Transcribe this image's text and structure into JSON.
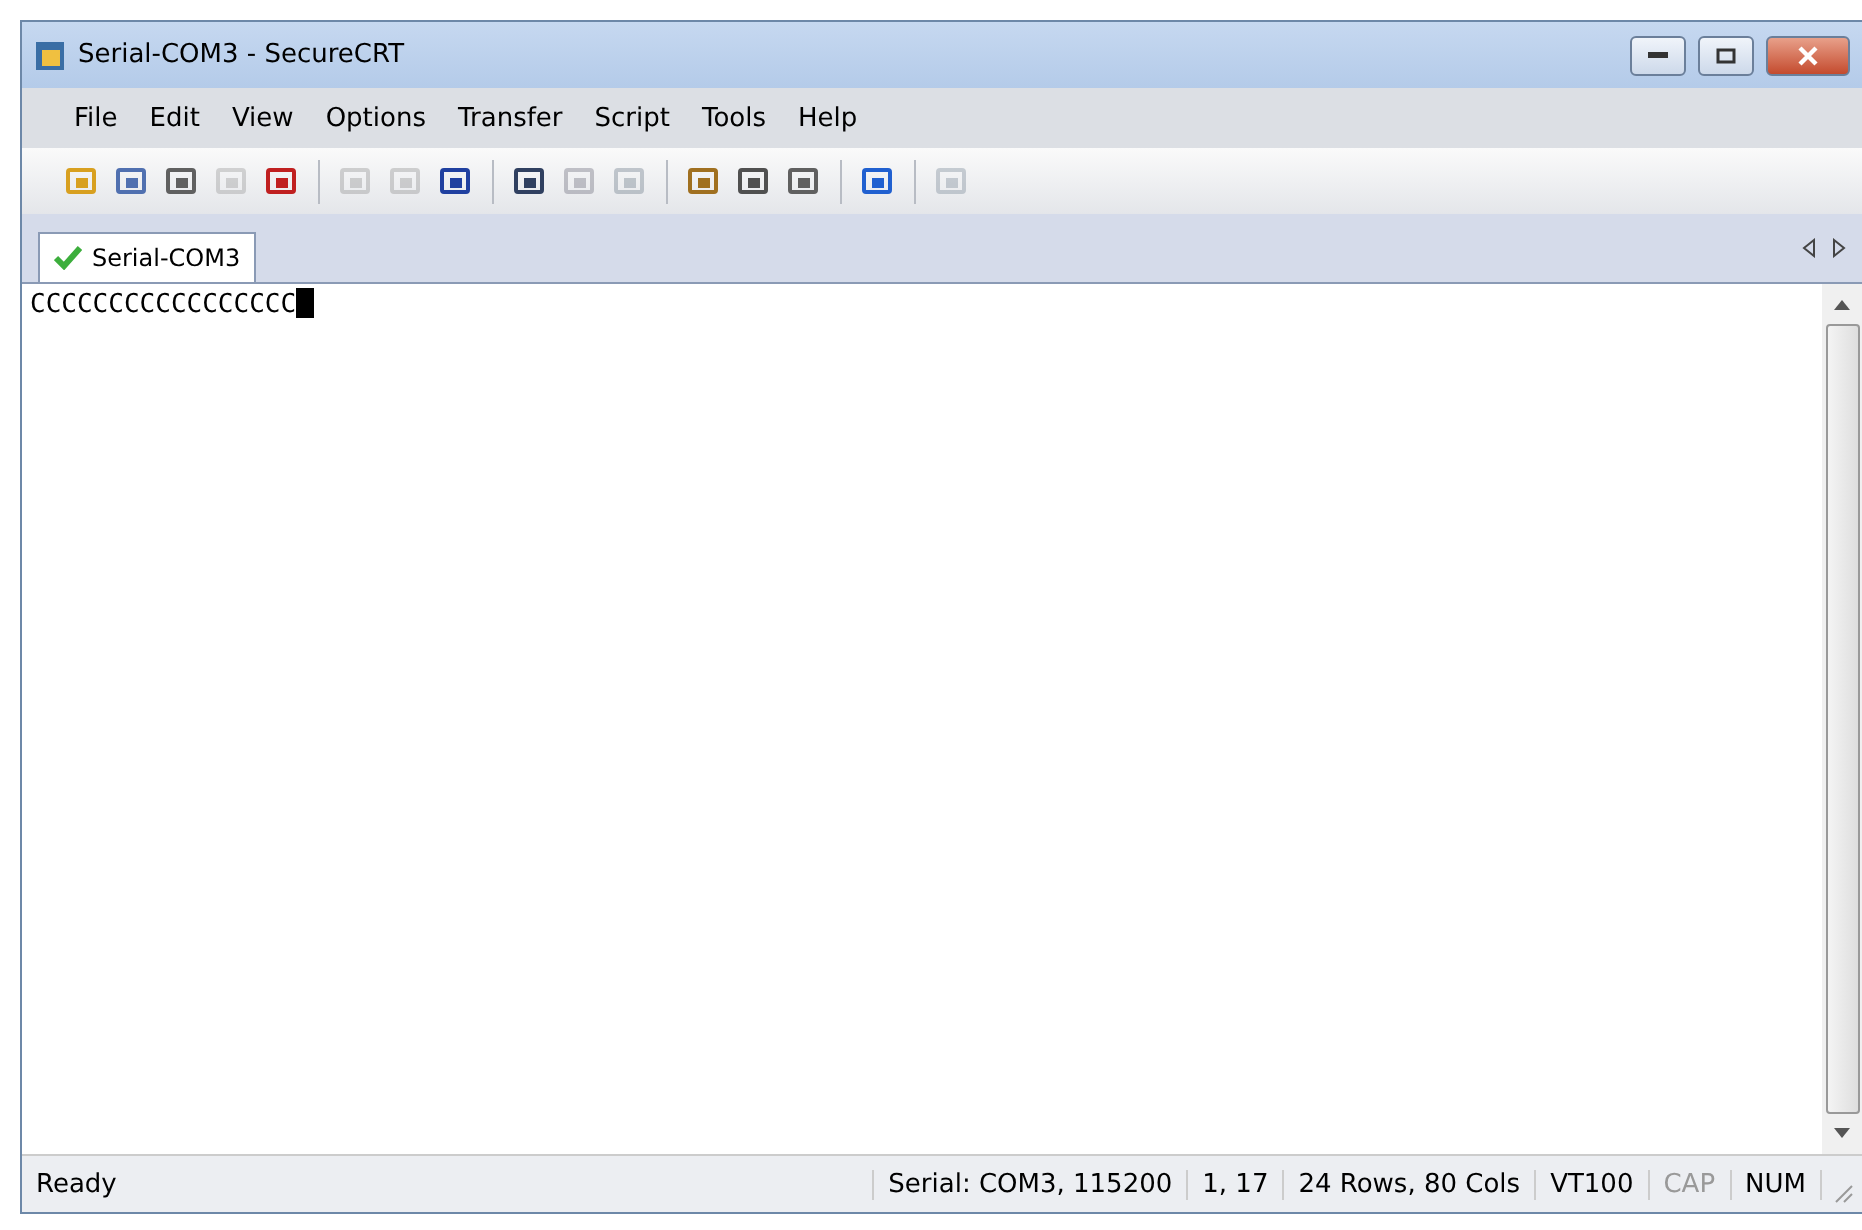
{
  "window": {
    "title": "Serial-COM3 - SecureCRT"
  },
  "menu": [
    "File",
    "Edit",
    "View",
    "Options",
    "Transfer",
    "Script",
    "Tools",
    "Help"
  ],
  "toolbar": [
    {
      "kind": "button",
      "disabled": false
    },
    {
      "kind": "button",
      "disabled": false
    },
    {
      "kind": "button",
      "disabled": false
    },
    {
      "kind": "button",
      "disabled": true
    },
    {
      "kind": "button",
      "disabled": false
    },
    {
      "kind": "separator"
    },
    {
      "kind": "button",
      "disabled": true
    },
    {
      "kind": "button",
      "disabled": true
    },
    {
      "kind": "button",
      "disabled": false
    },
    {
      "kind": "separator"
    },
    {
      "kind": "button",
      "disabled": false
    },
    {
      "kind": "button",
      "disabled": true
    },
    {
      "kind": "button",
      "disabled": true
    },
    {
      "kind": "separator"
    },
    {
      "kind": "button",
      "disabled": false
    },
    {
      "kind": "button",
      "disabled": false
    },
    {
      "kind": "button",
      "disabled": false
    },
    {
      "kind": "separator"
    },
    {
      "kind": "button",
      "disabled": false
    },
    {
      "kind": "separator"
    },
    {
      "kind": "button",
      "disabled": true
    }
  ],
  "tabs": [
    {
      "label": "Serial-COM3",
      "selected": true
    }
  ],
  "terminal": {
    "text": "CCCCCCCCCCCCCCCCC"
  },
  "status_bar": [
    {
      "text": "Ready",
      "disabled": false
    },
    {
      "text": "Serial: COM3, 115200",
      "disabled": false
    },
    {
      "text": "1,  17",
      "disabled": false
    },
    {
      "text": "24 Rows,  80 Cols",
      "disabled": false
    },
    {
      "text": "VT100",
      "disabled": false
    },
    {
      "text": "CAP",
      "disabled": true
    },
    {
      "text": "NUM",
      "disabled": false
    }
  ]
}
